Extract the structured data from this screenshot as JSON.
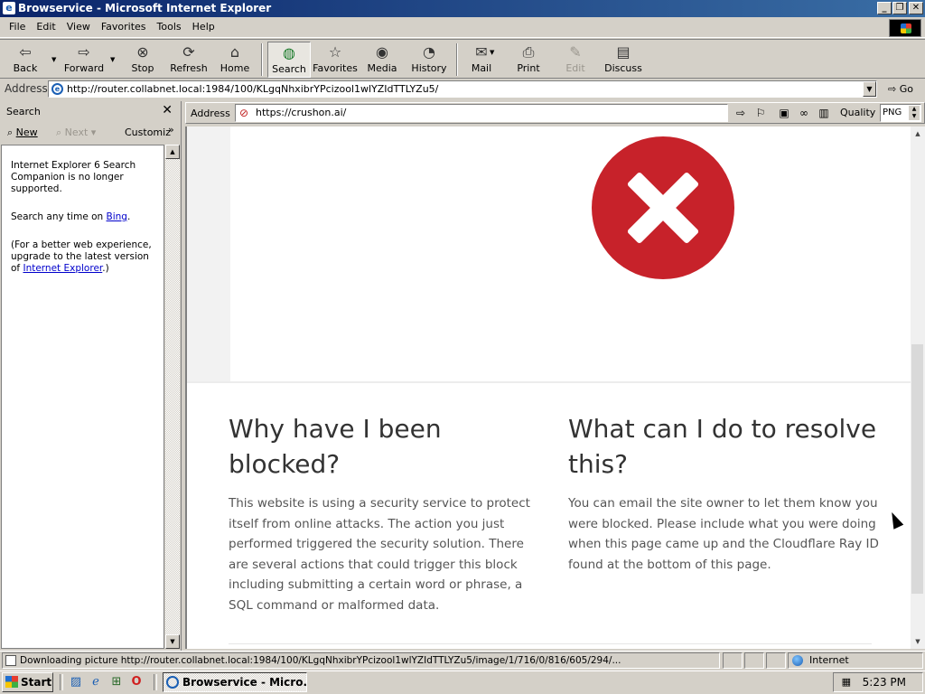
{
  "window": {
    "title": "Browservice - Microsoft Internet Explorer",
    "controls": [
      "_",
      "❐",
      "✕"
    ]
  },
  "menu": [
    "File",
    "Edit",
    "View",
    "Favorites",
    "Tools",
    "Help"
  ],
  "toolbar": {
    "back": "Back",
    "forward": "Forward",
    "stop": "Stop",
    "refresh": "Refresh",
    "home": "Home",
    "search": "Search",
    "favorites": "Favorites",
    "media": "Media",
    "history": "History",
    "mail": "Mail",
    "print": "Print",
    "edit": "Edit",
    "discuss": "Discuss"
  },
  "address_bar": {
    "label": "Address",
    "url": "http://router.collabnet.local:1984/100/KLgqNhxibrYPcizool1wlYZIdTTLYZu5/",
    "go": "Go"
  },
  "search_pane": {
    "title": "Search",
    "close": "✕",
    "new": "New",
    "next": "Next",
    "customize": "Customiz",
    "more": "»",
    "message": "Internet Explorer 6 Search Companion is no longer supported.",
    "search_prefix": "Search any time on ",
    "bing_link": "Bing",
    "search_suffix": ".",
    "upgrade_prefix": "(For a better web experience, upgrade to the latest version of ",
    "ie_link": "Internet Explorer",
    "upgrade_suffix": ".)"
  },
  "inner_browser": {
    "address_label": "Address",
    "url": "https://crushon.ai/",
    "quality_label": "Quality",
    "quality_value": "PNG"
  },
  "page": {
    "why_heading": "Why have I been blocked?",
    "why_text": "This website is using a security service to protect itself from online attacks. The action you just performed triggered the security solution. There are several actions that could trigger this block including submitting a certain word or phrase, a SQL command or malformed data.",
    "what_heading": "What can I do to resolve this?",
    "what_text": "You can email the site owner to let them know you were blocked. Please include what you were doing when this page came up and the Cloudflare Ray ID found at the bottom of this page.",
    "error_color": "#c7222a"
  },
  "status_bar": {
    "text": "Downloading picture http://router.collabnet.local:1984/100/KLgqNhxibrYPcizool1wlYZIdTTLYZu5/image/1/716/0/816/605/294/...",
    "zone": "Internet"
  },
  "taskbar": {
    "start": "Start",
    "task": "Browservice - Micro...",
    "clock": "5:23 PM"
  },
  "icons": {
    "back": "back-arrow-icon",
    "forward": "forward-arrow-icon",
    "stop": "stop-icon",
    "refresh": "refresh-icon",
    "home": "home-icon",
    "search": "search-globe-icon",
    "favorites": "favorites-folder-icon",
    "media": "media-icon",
    "history": "history-icon",
    "mail": "mail-icon",
    "print": "printer-icon",
    "edit": "edit-icon",
    "discuss": "discuss-icon",
    "error": "error-x-icon"
  }
}
